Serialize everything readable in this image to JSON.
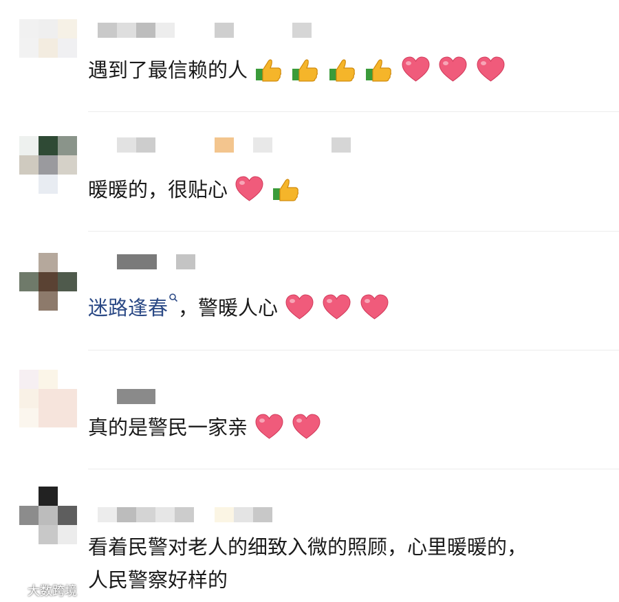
{
  "colors": {
    "text": "#1a1a1a",
    "link": "#2c4a86",
    "divider": "#ececec"
  },
  "comments": [
    {
      "text": "遇到了最信赖的人",
      "emojis": [
        "thumbs-up-icon",
        "thumbs-up-icon",
        "thumbs-up-icon",
        "thumbs-up-icon",
        "heart-icon",
        "heart-icon",
        "heart-icon"
      ]
    },
    {
      "text": "暖暖的，很贴心",
      "emojis": [
        "heart-icon",
        "thumbs-up-icon"
      ]
    },
    {
      "link_text": "迷路逢春",
      "text_after": "，警暖人心",
      "emojis": [
        "heart-icon",
        "heart-icon",
        "heart-icon"
      ]
    },
    {
      "text": "真的是警民一家亲",
      "emojis": [
        "heart-icon",
        "heart-icon"
      ]
    },
    {
      "text_line1": "看着民警对老人的细致入微的照顾，心里暖暖的，",
      "text_line2": "人民警察好样的"
    }
  ],
  "watermark": {
    "label": "大数跨境"
  }
}
